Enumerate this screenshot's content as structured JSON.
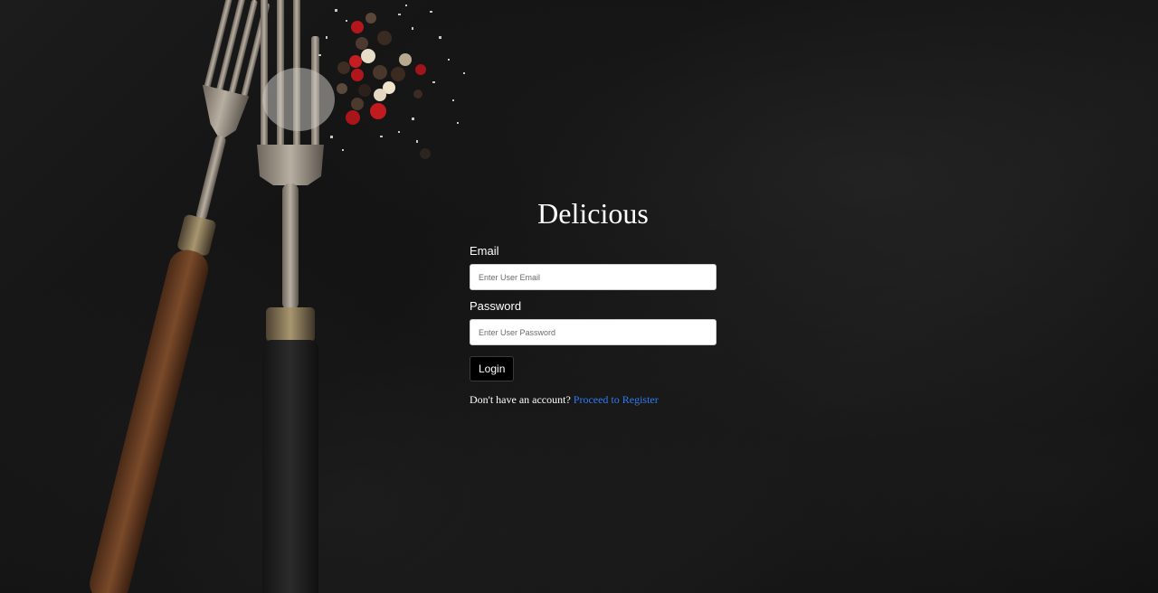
{
  "brand": {
    "title": "Delicious"
  },
  "form": {
    "email_label": "Email",
    "email_placeholder": "Enter User Email",
    "email_value": "",
    "password_label": "Password",
    "password_placeholder": "Enter User Password",
    "password_value": "",
    "login_label": "Login"
  },
  "footer": {
    "prompt": "Don't have an account?",
    "register_link": "Proceed to Register"
  },
  "colors": {
    "background": "#111111",
    "link": "#2f7bf0",
    "button": "#000000"
  }
}
